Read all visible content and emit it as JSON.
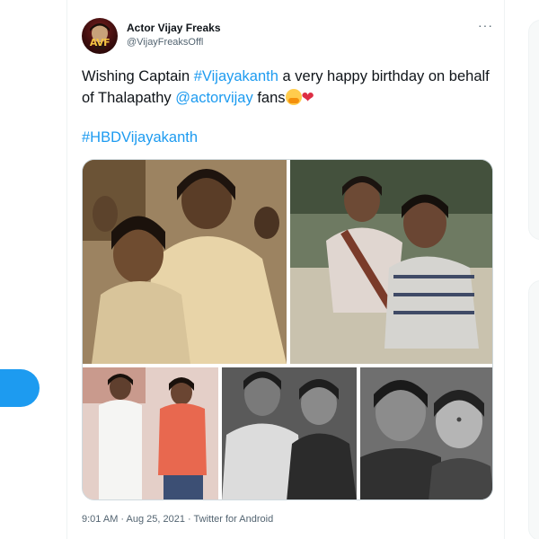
{
  "tweet": {
    "author_name": "Actor Vijay Freaks",
    "author_handle": "@VijayFreaksOffl",
    "avatar_text": "AVF",
    "more_label": "···",
    "text": {
      "part1": "Wishing Captain ",
      "mention1": "#Vijayakanth",
      "part2": " a very happy birthday on behalf of Thalapathy ",
      "mention2": "@actorvijay",
      "part3": " fans"
    },
    "hashtag": "#HBDVijayakanth",
    "media_count": 5,
    "meta": "9:01 AM · Aug 25, 2021 · Twitter for Android"
  },
  "icons": {
    "more": "more-options-icon",
    "emoji_hug": "hugging-face-emoji",
    "emoji_heart": "red-heart-emoji"
  },
  "colors": {
    "link": "#1d9bf0",
    "text": "#0f1419",
    "muted": "#536471"
  }
}
